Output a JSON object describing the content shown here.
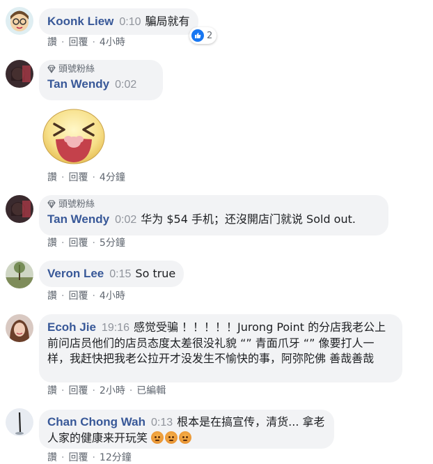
{
  "actions": {
    "read": "讚",
    "reply": "回覆",
    "sep": "·",
    "edited": "已編輯"
  },
  "badge": "頭號粉絲",
  "comments": [
    {
      "name": "Koonk Liew",
      "ts": "0:10",
      "text": "騙局就有",
      "time": "4小時",
      "reaction_count": "2"
    },
    {
      "name": "Tan Wendy",
      "ts": "0:02",
      "text": "",
      "time": "4分鐘"
    },
    {
      "name": "Tan Wendy",
      "ts": "0:02",
      "text": "华为 $54 手机；还沒開店门就说 Sold out.",
      "time": "5分鐘"
    },
    {
      "name": "Veron Lee",
      "ts": "0:15",
      "text": "So true",
      "time": "4小時"
    },
    {
      "name": "Ecoh Jie",
      "ts": "19:16",
      "text": "感觉受骗 ！！！！！Jurong Point 的分店我老公上前问店员他们的店员态度太差很没礼貌 “” 青面爪牙 “” 像要打人一样，我赶快把我老公拉开才没发生不愉快的事，阿弥陀佛 善哉善哉",
      "time": "2小時"
    },
    {
      "name": "Chan Chong Wah",
      "ts": "0:13",
      "text": "根本是在搞宣传，清货... 拿老人家的健康来开玩笑",
      "time": "12分鐘"
    }
  ],
  "colors": {
    "name": "#385898",
    "bubble": "#f2f3f5",
    "meta": "#606770",
    "like": "#1877f2"
  }
}
